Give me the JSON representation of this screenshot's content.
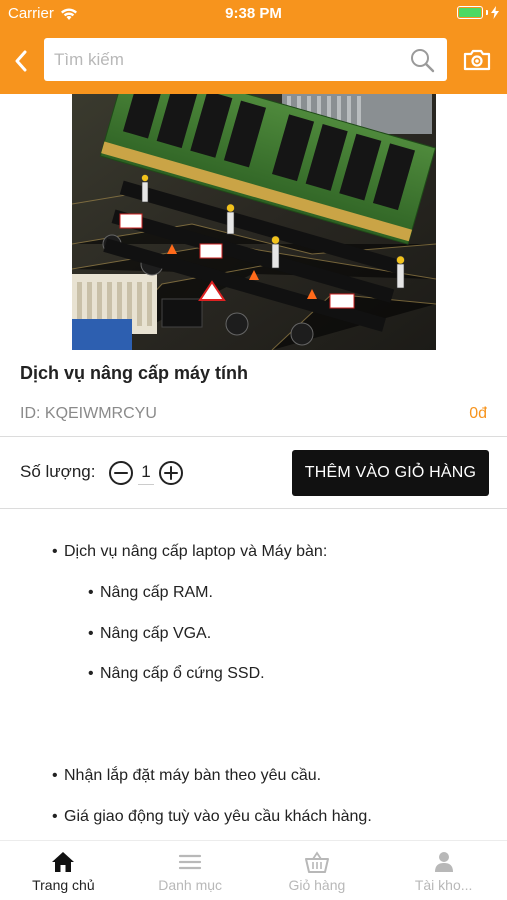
{
  "status_bar": {
    "carrier": "Carrier",
    "time": "9:38 PM"
  },
  "search": {
    "placeholder": "Tìm kiếm",
    "value": ""
  },
  "product": {
    "title": "Dịch vụ nâng cấp máy tính",
    "id_text": "ID: KQEIWMRCYU",
    "price": "0đ"
  },
  "quantity": {
    "label": "Số lượng:",
    "value": "1"
  },
  "add_to_cart_label": "THÊM VÀO GIỎ HÀNG",
  "description": {
    "main_bullet": "Dịch vụ nâng cấp laptop và Máy bàn:",
    "sub_items": [
      "Nâng cấp RAM.",
      "Nâng cấp VGA.",
      "Nâng cấp ổ cứng SSD."
    ],
    "extra_items": [
      "Nhận lắp đặt máy bàn theo yêu cầu.",
      "Giá giao động tuỳ vào yêu cầu khách hàng."
    ]
  },
  "tabs": [
    {
      "label": "Trang chủ",
      "icon": "home-icon",
      "active": true
    },
    {
      "label": "Danh mục",
      "icon": "menu-icon",
      "active": false
    },
    {
      "label": "Giỏ hàng",
      "icon": "basket-icon",
      "active": false
    },
    {
      "label": "Tài kho...",
      "icon": "user-icon",
      "active": false
    }
  ],
  "colors": {
    "accent": "#f7941d",
    "button": "#111111",
    "tab_inactive": "#b8b8b8"
  }
}
